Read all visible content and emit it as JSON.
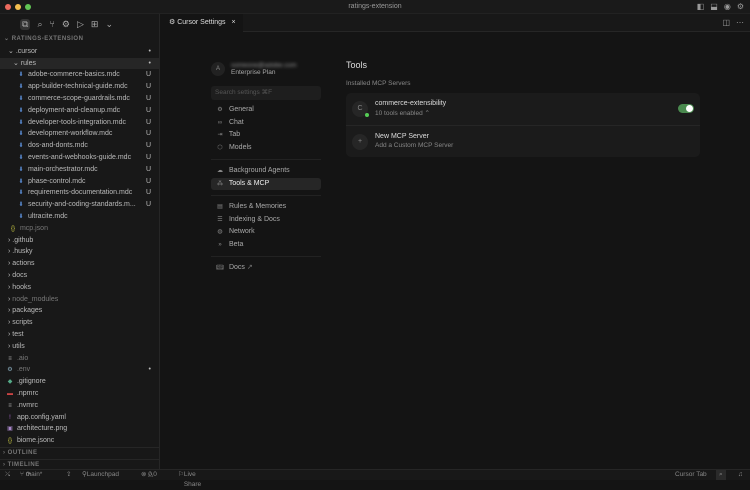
{
  "window": {
    "title": "ratings-extension"
  },
  "explorer": {
    "root": "RATINGS-EXTENSION",
    "cursor_folder": ".cursor",
    "rules_folder": "rules",
    "rules": [
      {
        "name": "adobe-commerce-basics.mdc",
        "status": "U"
      },
      {
        "name": "app-builder-technical-guide.mdc",
        "status": "U"
      },
      {
        "name": "commerce-scope-guardrails.mdc",
        "status": "U"
      },
      {
        "name": "deployment-and-cleanup.mdc",
        "status": "U"
      },
      {
        "name": "developer-tools-integration.mdc",
        "status": "U"
      },
      {
        "name": "development-workflow.mdc",
        "status": "U"
      },
      {
        "name": "dos-and-donts.mdc",
        "status": "U"
      },
      {
        "name": "events-and-webhooks-guide.mdc",
        "status": "U"
      },
      {
        "name": "main-orchestrator.mdc",
        "status": "U"
      },
      {
        "name": "phase-control.mdc",
        "status": "U"
      },
      {
        "name": "requirements-documentation.mdc",
        "status": "U"
      },
      {
        "name": "security-and-coding-standards.m...",
        "status": "U"
      },
      {
        "name": "ultracite.mdc",
        "status": ""
      }
    ],
    "mcp_json": "mcp.json",
    "folders": [
      ".github",
      ".husky",
      "actions",
      "docs",
      "hooks",
      "node_modules",
      "packages",
      "scripts",
      "test",
      "utils"
    ],
    "files": [
      {
        "name": ".aio",
        "icon": "≡",
        "color": "#aaa"
      },
      {
        "name": ".env",
        "icon": "⚙",
        "color": "#8ab"
      },
      {
        "name": ".gitignore",
        "icon": "◆",
        "color": "#5a8"
      },
      {
        "name": ".npmrc",
        "icon": "▬",
        "color": "#c44"
      },
      {
        "name": ".nvmrc",
        "icon": "≡",
        "color": "#aaa"
      },
      {
        "name": "app.config.yaml",
        "icon": "!",
        "color": "#a6c"
      },
      {
        "name": "architecture.png",
        "icon": "▣",
        "color": "#a8c"
      },
      {
        "name": "biome.jsonc",
        "icon": "{}",
        "color": "#cc4"
      }
    ],
    "outline": "OUTLINE",
    "timeline": "TIMELINE"
  },
  "tab": {
    "label": "Cursor Settings",
    "close": "×"
  },
  "settings": {
    "avatar": "A",
    "email": "someone@adobe.com",
    "plan": "Enterprise Plan",
    "search_placeholder": "Search settings ⌘F",
    "nav": [
      [
        "General",
        "⚙"
      ],
      [
        "Chat",
        "∞"
      ],
      [
        "Tab",
        "⇥"
      ],
      [
        "Models",
        "⬡"
      ]
    ],
    "nav2": [
      [
        "Background Agents",
        "☁"
      ],
      [
        "Tools & MCP",
        "⁂"
      ]
    ],
    "nav3": [
      [
        "Rules & Memories",
        "▤"
      ],
      [
        "Indexing & Docs",
        "☰"
      ],
      [
        "Network",
        "◍"
      ],
      [
        "Beta",
        "»"
      ]
    ],
    "docs": "Docs",
    "docs_ext": "↗"
  },
  "tools": {
    "title": "Tools",
    "section": "Installed MCP Servers",
    "server": {
      "avatar": "C",
      "name": "commerce-extensibility",
      "detail": "10 tools enabled ⌃",
      "enabled": true
    },
    "new": {
      "icon": "+",
      "title": "New MCP Server",
      "subtitle": "Add a Custom MCP Server"
    }
  },
  "statusbar": {
    "branch": "main*",
    "launchpad": "Launchpad",
    "errors": "0",
    "warnings": "0",
    "live_share": "Live Share",
    "cursor_tab": "Cursor Tab"
  }
}
